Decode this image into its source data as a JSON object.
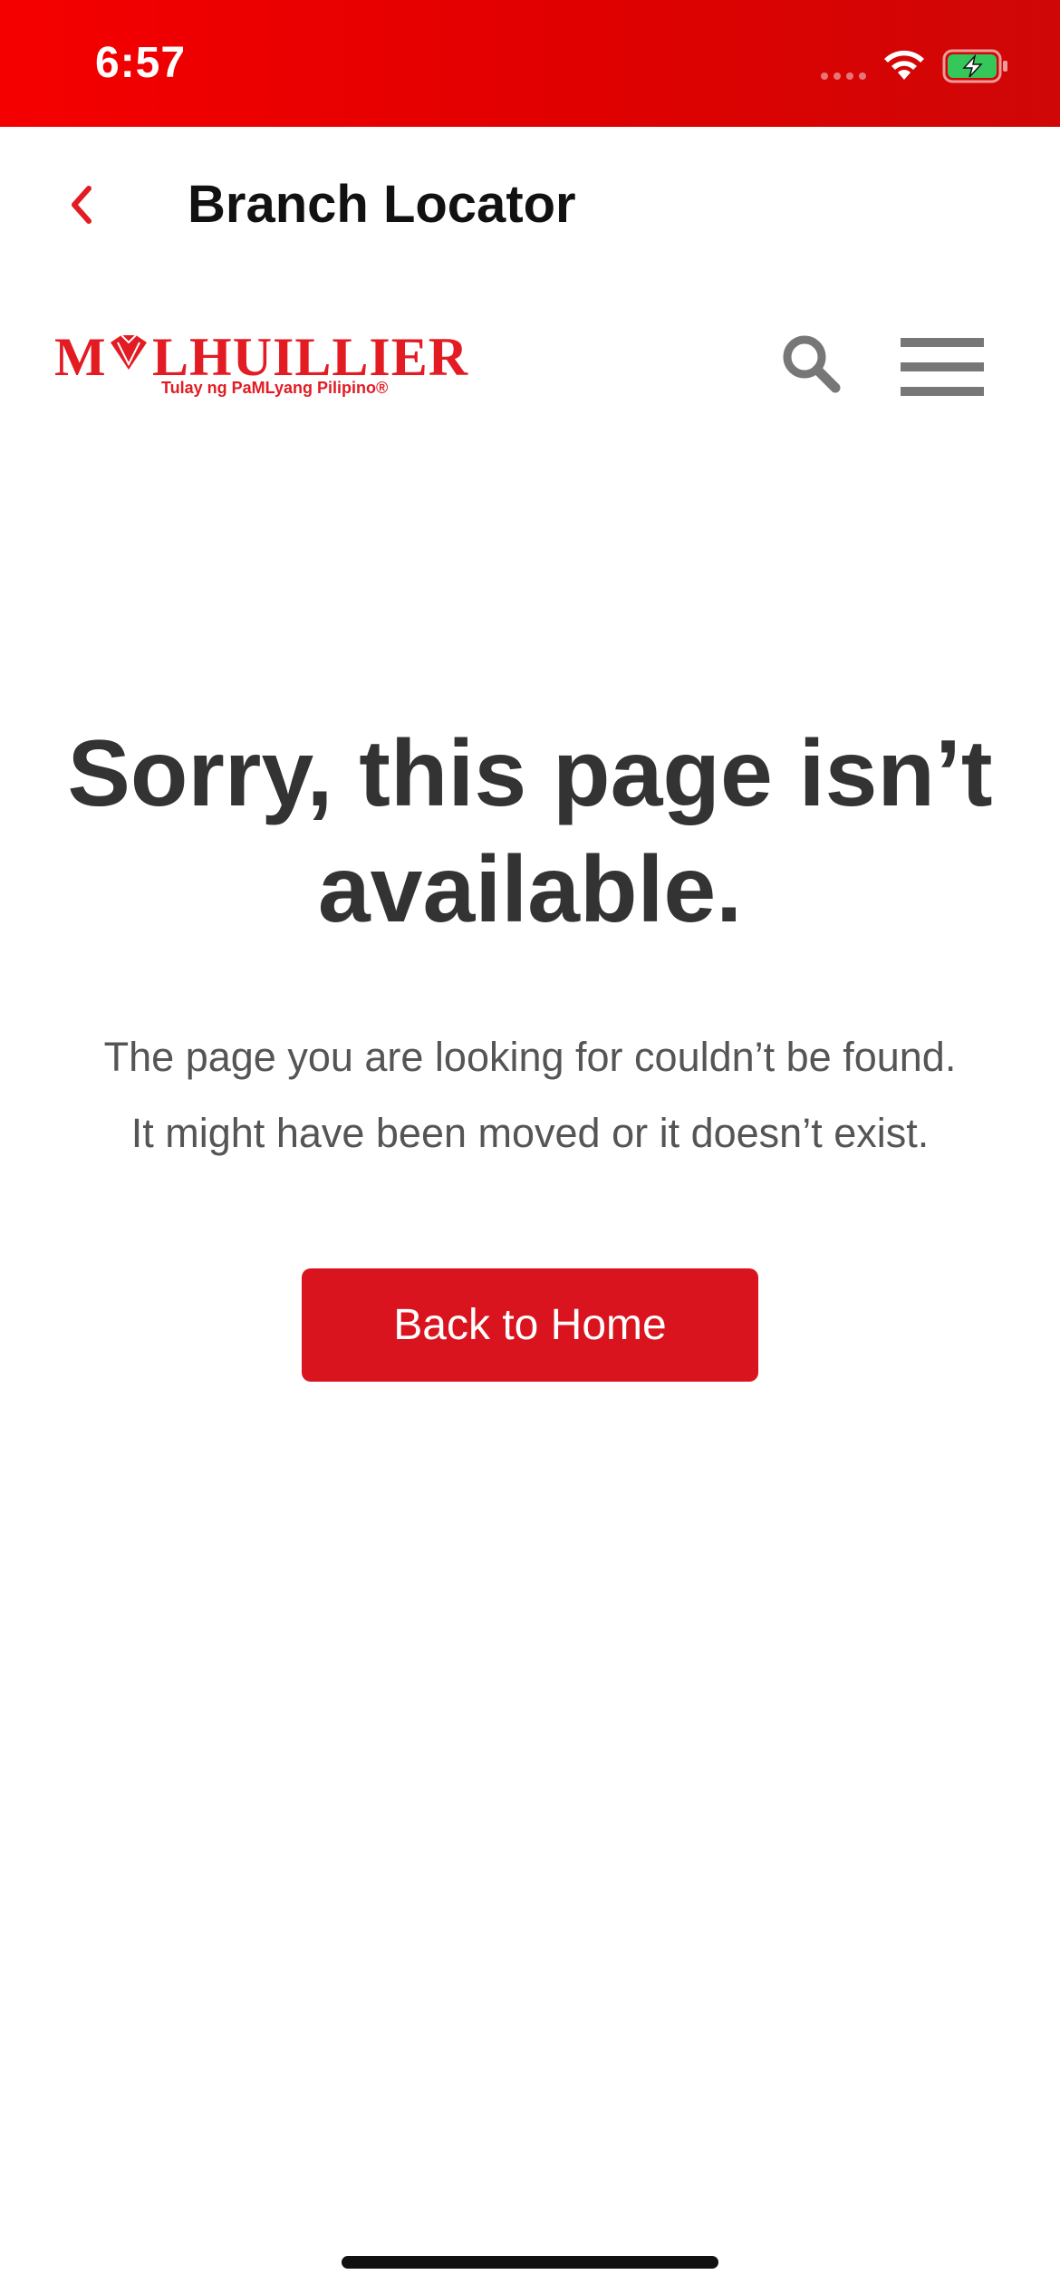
{
  "status_bar": {
    "time": "6:57",
    "wifi_icon": "wifi-icon",
    "battery_icon": "battery-charging-icon",
    "background_color": "#e00000"
  },
  "nav": {
    "back_icon": "chevron-left-icon",
    "title": "Branch Locator"
  },
  "site_header": {
    "logo_text": "M LHUILLIER",
    "logo_tagline": "Tulay ng PaMLyang Pilipino®",
    "search_icon": "search-icon",
    "menu_icon": "hamburger-menu-icon",
    "brand_color": "#e31b23"
  },
  "error": {
    "title": "Sorry, this page isn’t available.",
    "message_line1": "The page you are looking for couldn’t be found.",
    "message_line2": "It might have been moved or it doesn’t exist."
  },
  "actions": {
    "home_button_label": "Back to Home",
    "button_color": "#d9141e"
  }
}
